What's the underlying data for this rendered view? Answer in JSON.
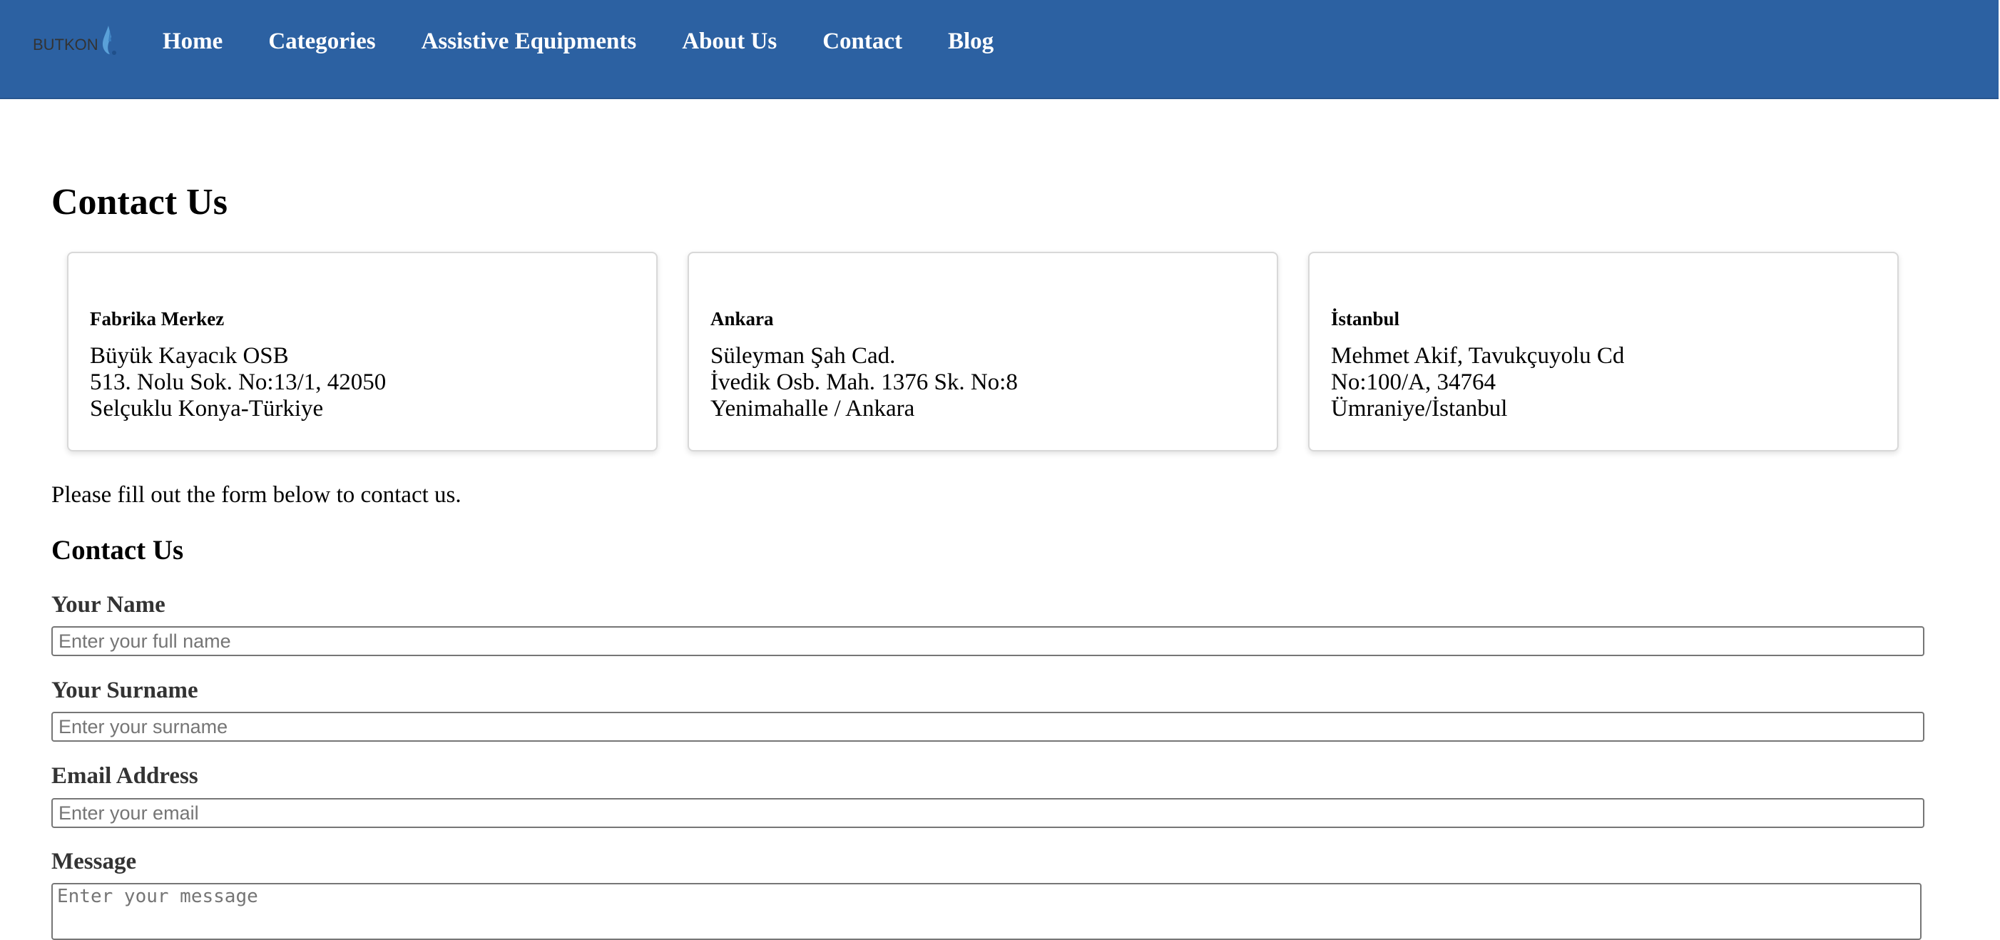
{
  "header": {
    "logo_text": "BUTKON",
    "nav": [
      {
        "label": "Home"
      },
      {
        "label": "Categories"
      },
      {
        "label": "Assistive Equipments"
      },
      {
        "label": "About Us"
      },
      {
        "label": "Contact"
      },
      {
        "label": "Blog"
      }
    ],
    "colors": {
      "background": "#2c61a2",
      "link": "#ffffff"
    }
  },
  "main": {
    "title": "Contact Us",
    "locations": [
      {
        "name": "Fabrika Merkez",
        "lines": [
          "Büyük Kayacık OSB",
          "513. Nolu Sok. No:13/1, 42050",
          "Selçuklu Konya-Türkiye"
        ]
      },
      {
        "name": "Ankara",
        "lines": [
          "Süleyman Şah Cad.",
          "İvedik Osb. Mah. 1376 Sk. No:8",
          "Yenimahalle / Ankara"
        ]
      },
      {
        "name": "İstanbul",
        "lines": [
          "Mehmet Akif, Tavukçuyolu Cd",
          "No:100/A, 34764",
          "Ümraniye/İstanbul"
        ]
      }
    ],
    "intro": "Please fill out the form below to contact us."
  },
  "form": {
    "title": "Contact Us",
    "name_label": "Your Name",
    "name_placeholder": "Enter your full name",
    "surname_label": "Your Surname",
    "surname_placeholder": "Enter your surname",
    "email_label": "Email Address",
    "email_placeholder": "Enter your email",
    "message_label": "Message",
    "message_placeholder": "Enter your message"
  }
}
